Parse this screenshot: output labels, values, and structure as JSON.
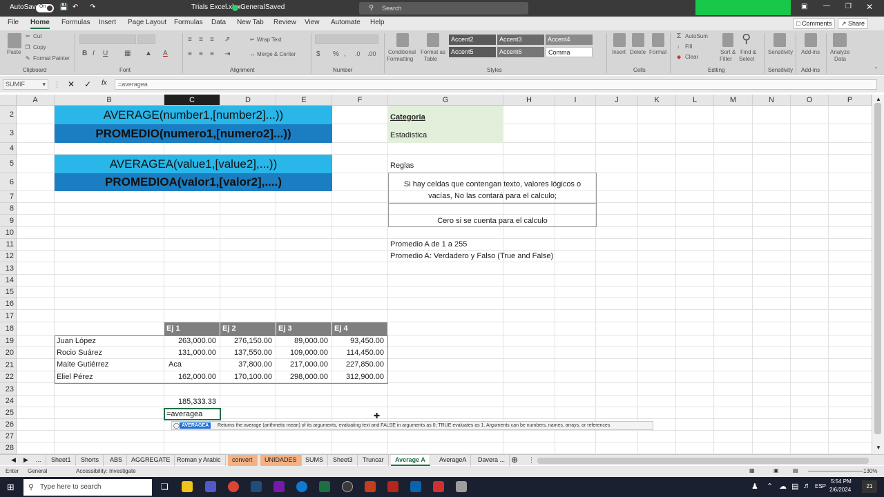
{
  "titlebar": {
    "autosave": "AutoSave",
    "toggle_state": "On",
    "filename": "Trials Excel.xlsx",
    "sensitivity": "General",
    "saved": "Saved",
    "search_placeholder": "Search"
  },
  "ribbon_tabs": [
    "File",
    "Home",
    "Formulas",
    "Insert",
    "Page Layout",
    "Formulas",
    "Data",
    "New Tab",
    "Review",
    "View",
    "Automate",
    "Help"
  ],
  "ribbon_buttons": {
    "comments": "Comments",
    "share": "Share"
  },
  "ribbon": {
    "paste": "Paste",
    "cut": "Cut",
    "copy": "Copy",
    "format_painter": "Format Painter",
    "wrap_text": "Wrap Text",
    "merge_center": "Merge & Center",
    "cond_formatting_1": "Conditional",
    "cond_formatting_2": "Formatting",
    "format_table_1": "Format as",
    "format_table_2": "Table",
    "styles": [
      "Accent2",
      "Accent3",
      "Accent4",
      "Accent5",
      "Accent6",
      "Comma"
    ],
    "insert": "Insert",
    "delete": "Delete",
    "format": "Format",
    "autosum": "AutoSum",
    "fill": "Fill",
    "clear": "Clear",
    "sort_filter_1": "Sort &",
    "sort_filter_2": "Filter",
    "find_select_1": "Find &",
    "find_select_2": "Select",
    "sensitivity": "Sensitivity",
    "addins": "Add-ins",
    "analyze_1": "Analyze",
    "analyze_2": "Data",
    "groups": [
      "Clipboard",
      "Font",
      "Alignment",
      "Number",
      "Styles",
      "Cells",
      "Editing",
      "Sensitivity",
      "Add-ins"
    ]
  },
  "formula_bar": {
    "namebox": "SUMIF",
    "fx": "fx",
    "formula": "=averagea"
  },
  "columns": [
    "A",
    "B",
    "C",
    "D",
    "E",
    "F",
    "G",
    "H",
    "I",
    "J",
    "K",
    "L",
    "M",
    "N",
    "O",
    "P"
  ],
  "rows": [
    "2",
    "3",
    "4",
    "5",
    "6",
    "7",
    "8",
    "9",
    "10",
    "11",
    "12",
    "13",
    "14",
    "15",
    "16",
    "17",
    "18",
    "19",
    "20",
    "21",
    "22",
    "23",
    "24",
    "25",
    "26",
    "27",
    "28"
  ],
  "banners": {
    "average_en": "AVERAGE(number1,[number2]...))",
    "average_es": "PROMEDIO(numero1,[numero2]...))",
    "averagea_en": "AVERAGEA(value1,[value2],...))",
    "averagea_es": "PROMEDIOA(valor1,[valor2],....)"
  },
  "info": {
    "categoria_label": "Categoria",
    "categoria_value": "Estadistica",
    "reglas_label": "Reglas",
    "regla_1": "Si hay celdas que contengan texto, valores lógicos o vacías, No las contará para el calculo;",
    "regla_2": "Cero si se cuenta para el calculo",
    "note_1": "Promedio A de 1 a 255",
    "note_2": "Promedio A: Verdadero y Falso (True and False)"
  },
  "table": {
    "headers": [
      "Ej 1",
      "Ej 2",
      "Ej 3",
      "Ej 4"
    ],
    "rows": [
      {
        "name": "Juan López",
        "values": [
          "263,000.00",
          "276,150.00",
          "89,000.00",
          "93,450.00"
        ]
      },
      {
        "name": "Rocio Suárez",
        "values": [
          "131,000.00",
          "137,550.00",
          "109,000.00",
          "114,450.00"
        ]
      },
      {
        "name": "Maite Gutiérrez",
        "values": [
          "Aca",
          "37,800.00",
          "217,000.00",
          "227,850.00"
        ]
      },
      {
        "name": "Eliel Pérez",
        "values": [
          "162,000.00",
          "170,100.00",
          "298,000.00",
          "312,900.00"
        ]
      }
    ],
    "c24": "185,333.33",
    "c25_edit": "=averagea"
  },
  "autocomplete": {
    "function": "AVERAGEA",
    "tooltip": "Returns the average (arithmetic mean) of its arguments, evaluating text and FALSE in arguments as 0; TRUE evaluates as 1. Arguments can be numbers, names, arrays, or references"
  },
  "sheet_tabs": [
    "...",
    "Sheet1",
    "Shorts",
    "ABS",
    "AGGREGATE",
    "Roman y Arabic",
    "convert",
    "UNIDADES",
    "SUMS",
    "Sheet3",
    "Truncar",
    "Average  A",
    "AverageA",
    "Davera ..."
  ],
  "status": {
    "mode": "Enter",
    "general": "General",
    "accessibility": "Accessibility: Investigate",
    "zoom": "130%"
  },
  "taskbar": {
    "search_placeholder": "Type here to search",
    "time": "5:54 PM",
    "date": "2/6/2024",
    "lang": "ESP",
    "notif": "21"
  },
  "colors": {
    "banner_light": "#29b6e8",
    "banner_dark": "#1b7ec2",
    "categoria_bg": "#e2efda",
    "excel_green": "#1d6f42",
    "tab_orange": "#f4b183"
  }
}
